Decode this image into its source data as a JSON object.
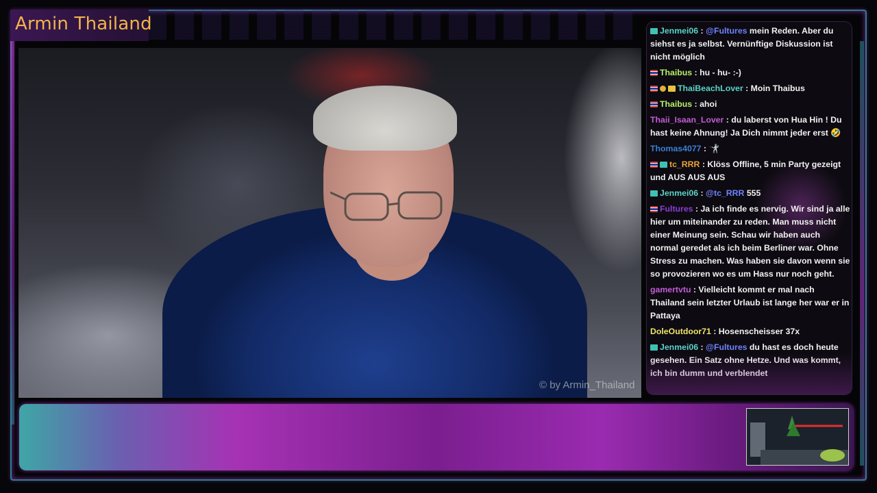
{
  "stream": {
    "title": "Armin Thailand",
    "watermark": "© by Armin_Thailand"
  },
  "colors": {
    "title": "#f2b44a",
    "mention": "#6f82ff",
    "frame_teal": "#2a7f8c",
    "frame_purple": "#a632b4"
  },
  "chat": {
    "partial_top_text": "...",
    "messages": [
      {
        "badges": [
          "sub"
        ],
        "user": "Jenmei06",
        "user_color": "#5ad3c8",
        "mention": "@Fultures",
        "text": " mein Reden. Aber du siehst es ja selbst. Vernünftige Diskussion ist nicht möglich"
      },
      {
        "badges": [
          "th"
        ],
        "user": "Thaibus",
        "user_color": "#b6f06a",
        "mention": "",
        "text": "hu - hu- :-)"
      },
      {
        "badges": [
          "th",
          "gold",
          "crown"
        ],
        "user": "ThaiBeachLover",
        "user_color": "#5ad3c8",
        "mention": "",
        "text": "Moin Thaibus"
      },
      {
        "badges": [
          "th"
        ],
        "user": "Thaibus",
        "user_color": "#b6f06a",
        "mention": "",
        "text": "ahoi"
      },
      {
        "badges": [],
        "user": "Thaii_Isaan_Lover",
        "user_color": "#c45bd8",
        "mention": "",
        "text": "du laberst von Hua Hin ! Du hast keine Ahnung! Ja Dich nimmt jeder erst 🤣"
      },
      {
        "badges": [],
        "user": "Thomas4077",
        "user_color": "#3b7fd8",
        "mention": "",
        "text": "🤺"
      },
      {
        "badges": [
          "th",
          "sub"
        ],
        "user": "tc_RRR",
        "user_color": "#e8a33a",
        "mention": "",
        "text": "Klöss Offline, 5 min Party gezeigt und AUS AUS AUS"
      },
      {
        "badges": [
          "sub"
        ],
        "user": "Jenmei06",
        "user_color": "#5ad3c8",
        "mention": "@tc_RRR",
        "text": " 555"
      },
      {
        "badges": [
          "th"
        ],
        "user": "Fultures",
        "user_color": "#8a3fd6",
        "mention": "",
        "text": "Ja ich finde es nervig. Wir sind ja alle hier um miteinander zu reden. Man muss nicht einer Meinung sein. Schau wir haben auch normal geredet als ich beim Berliner war. Ohne Stress zu machen. Was haben sie davon wenn sie so provozieren wo es um Hass nur noch geht."
      },
      {
        "badges": [],
        "user": "gamertvtu",
        "user_color": "#c45bd8",
        "mention": "",
        "text": "Vielleicht kommt er mal nach Thailand sein letzter Urlaub ist lange her war er in Pattaya"
      },
      {
        "badges": [],
        "user": "DoleOutdoor71",
        "user_color": "#f0e36a",
        "mention": "",
        "text": "Hosenscheisser 37x"
      },
      {
        "badges": [
          "sub"
        ],
        "user": "Jenmei06",
        "user_color": "#5ad3c8",
        "mention": "@Fultures",
        "text": " du hast es doch heute gesehen. Ein Satz ohne Hetze. Und was kommt, ich bin dumm und verblendet"
      }
    ]
  }
}
